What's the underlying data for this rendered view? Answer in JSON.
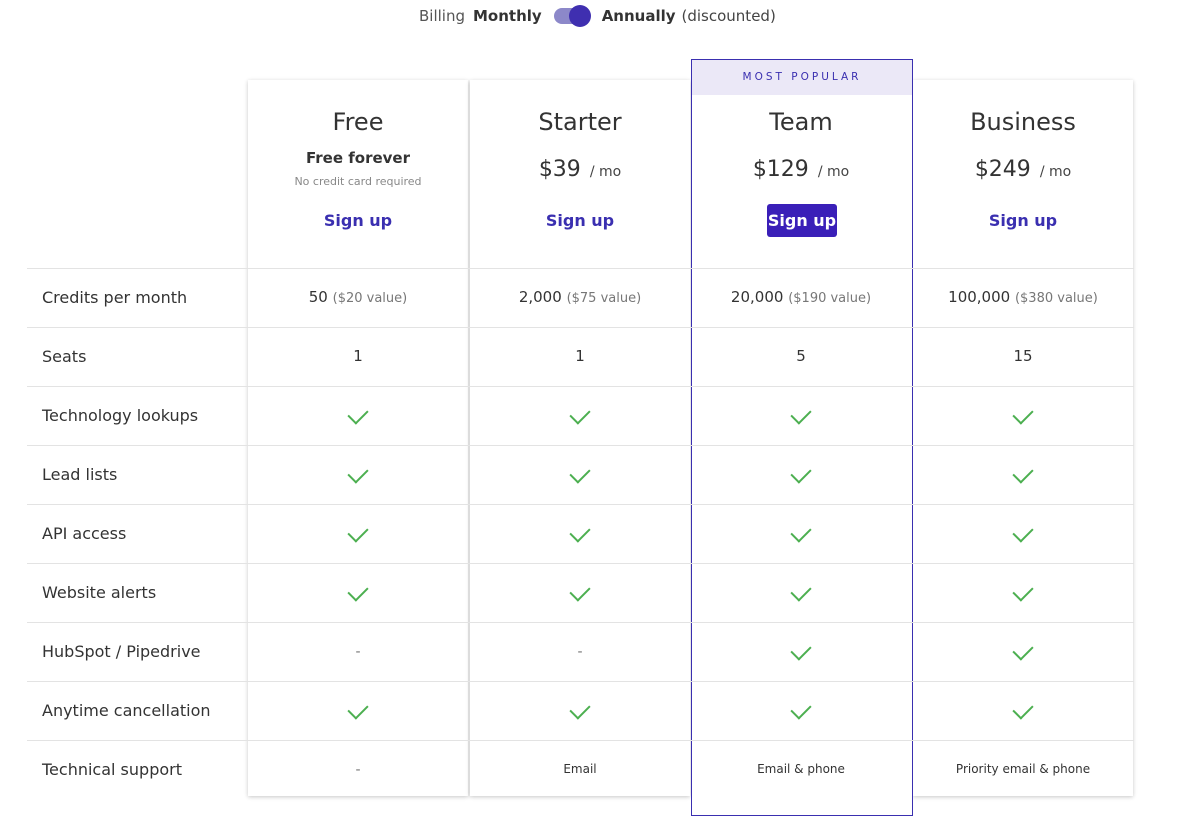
{
  "billing": {
    "label": "Billing",
    "monthly": "Monthly",
    "annually": "Annually",
    "discount_note": "(discounted)",
    "annual_selected": true
  },
  "plans": [
    {
      "name": "Free",
      "headline": "Free forever",
      "note": "No credit card required",
      "signup": "Sign up"
    },
    {
      "name": "Starter",
      "price": "$39",
      "per": "/ mo",
      "signup": "Sign up"
    },
    {
      "name": "Team",
      "badge": "MOST POPULAR",
      "price": "$129",
      "per": "/ mo",
      "signup": "Sign up"
    },
    {
      "name": "Business",
      "price": "$249",
      "per": "/ mo",
      "signup": "Sign up"
    }
  ],
  "features": [
    {
      "label": "Credits per month",
      "values": [
        {
          "main": "50",
          "sub": "($20 value)"
        },
        {
          "main": "2,000",
          "sub": "($75 value)"
        },
        {
          "main": "20,000",
          "sub": "($190 value)"
        },
        {
          "main": "100,000",
          "sub": "($380 value)"
        }
      ]
    },
    {
      "label": "Seats",
      "values": [
        {
          "main": "1"
        },
        {
          "main": "1"
        },
        {
          "main": "5"
        },
        {
          "main": "15"
        }
      ]
    },
    {
      "label": "Technology lookups",
      "values": [
        "check",
        "check",
        "check",
        "check"
      ]
    },
    {
      "label": "Lead lists",
      "values": [
        "check",
        "check",
        "check",
        "check"
      ]
    },
    {
      "label": "API access",
      "values": [
        "check",
        "check",
        "check",
        "check"
      ]
    },
    {
      "label": "Website alerts",
      "values": [
        "check",
        "check",
        "check",
        "check"
      ]
    },
    {
      "label": "HubSpot / Pipedrive",
      "values": [
        "-",
        "-",
        "check",
        "check"
      ]
    },
    {
      "label": "Anytime cancellation",
      "values": [
        "check",
        "check",
        "check",
        "check"
      ]
    },
    {
      "label": "Technical support",
      "values": [
        "-",
        "Email",
        "Email & phone",
        "Priority email & phone"
      ]
    }
  ],
  "colors": {
    "accent": "#3a2fb0",
    "check": "#4caf50",
    "badge_bg": "#ebe8f7"
  },
  "icons": {
    "included": "check-icon",
    "not_included": "dash"
  }
}
